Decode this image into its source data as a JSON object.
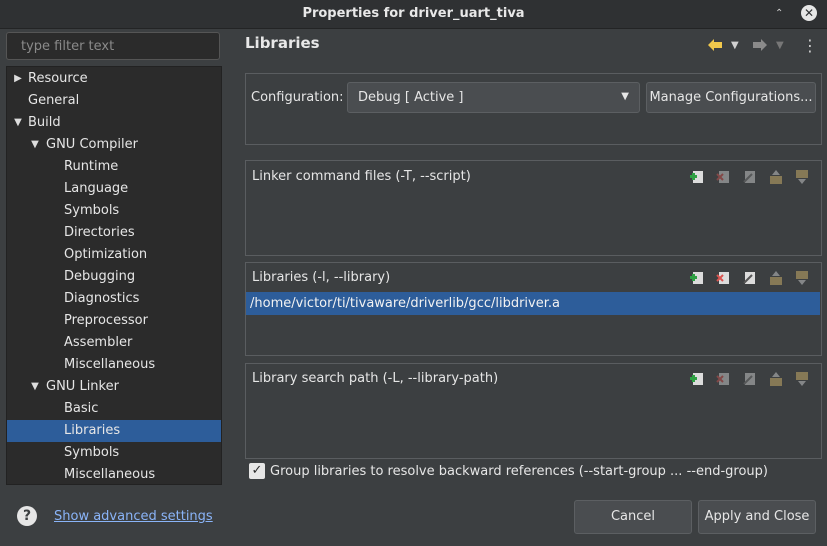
{
  "window": {
    "title": "Properties for driver_uart_tiva"
  },
  "filter": {
    "placeholder": "type filter text"
  },
  "tree": [
    {
      "label": "Resource",
      "level": 0,
      "arrow": "collapsed"
    },
    {
      "label": "General",
      "level": 0,
      "arrow": "none"
    },
    {
      "label": "Build",
      "level": 0,
      "arrow": "expanded"
    },
    {
      "label": "GNU Compiler",
      "level": 1,
      "arrow": "expanded"
    },
    {
      "label": "Runtime",
      "level": 2,
      "arrow": "none"
    },
    {
      "label": "Language",
      "level": 2,
      "arrow": "none"
    },
    {
      "label": "Symbols",
      "level": 2,
      "arrow": "none"
    },
    {
      "label": "Directories",
      "level": 2,
      "arrow": "none"
    },
    {
      "label": "Optimization",
      "level": 2,
      "arrow": "none"
    },
    {
      "label": "Debugging",
      "level": 2,
      "arrow": "none"
    },
    {
      "label": "Diagnostics",
      "level": 2,
      "arrow": "none"
    },
    {
      "label": "Preprocessor",
      "level": 2,
      "arrow": "none"
    },
    {
      "label": "Assembler",
      "level": 2,
      "arrow": "none"
    },
    {
      "label": "Miscellaneous",
      "level": 2,
      "arrow": "none"
    },
    {
      "label": "GNU Linker",
      "level": 1,
      "arrow": "expanded"
    },
    {
      "label": "Basic",
      "level": 2,
      "arrow": "none"
    },
    {
      "label": "Libraries",
      "level": 2,
      "arrow": "none",
      "selected": true
    },
    {
      "label": "Symbols",
      "level": 2,
      "arrow": "none"
    },
    {
      "label": "Miscellaneous",
      "level": 2,
      "arrow": "none"
    }
  ],
  "page": {
    "title": "Libraries"
  },
  "config": {
    "label": "Configuration:",
    "value": "Debug  [ Active ]",
    "manage_label": "Manage Configurations..."
  },
  "linker_cmd": {
    "title": "Linker command files (-T, --script)"
  },
  "libraries": {
    "title": "Libraries (-l, --library)",
    "items": [
      "/home/victor/ti/tivaware/driverlib/gcc/libdriver.a"
    ]
  },
  "lib_path": {
    "title": "Library search path (-L, --library-path)"
  },
  "group_libs": {
    "label": "Group libraries to resolve backward references (--start-group ... --end-group)",
    "checked": true
  },
  "footer": {
    "advanced_link": "Show advanced settings",
    "cancel": "Cancel",
    "apply_close": "Apply and Close"
  },
  "colors": {
    "accent": "#2d5d9a",
    "background": "#3c3f41",
    "tree_bg": "#2b2b2b",
    "link": "#8ab4f8"
  },
  "icons": [
    "back-arrow-icon",
    "forward-arrow-icon",
    "menu-kebab-icon",
    "add-icon",
    "delete-icon",
    "edit-icon",
    "move-up-icon",
    "move-down-icon",
    "help-icon",
    "checkmark-icon"
  ]
}
